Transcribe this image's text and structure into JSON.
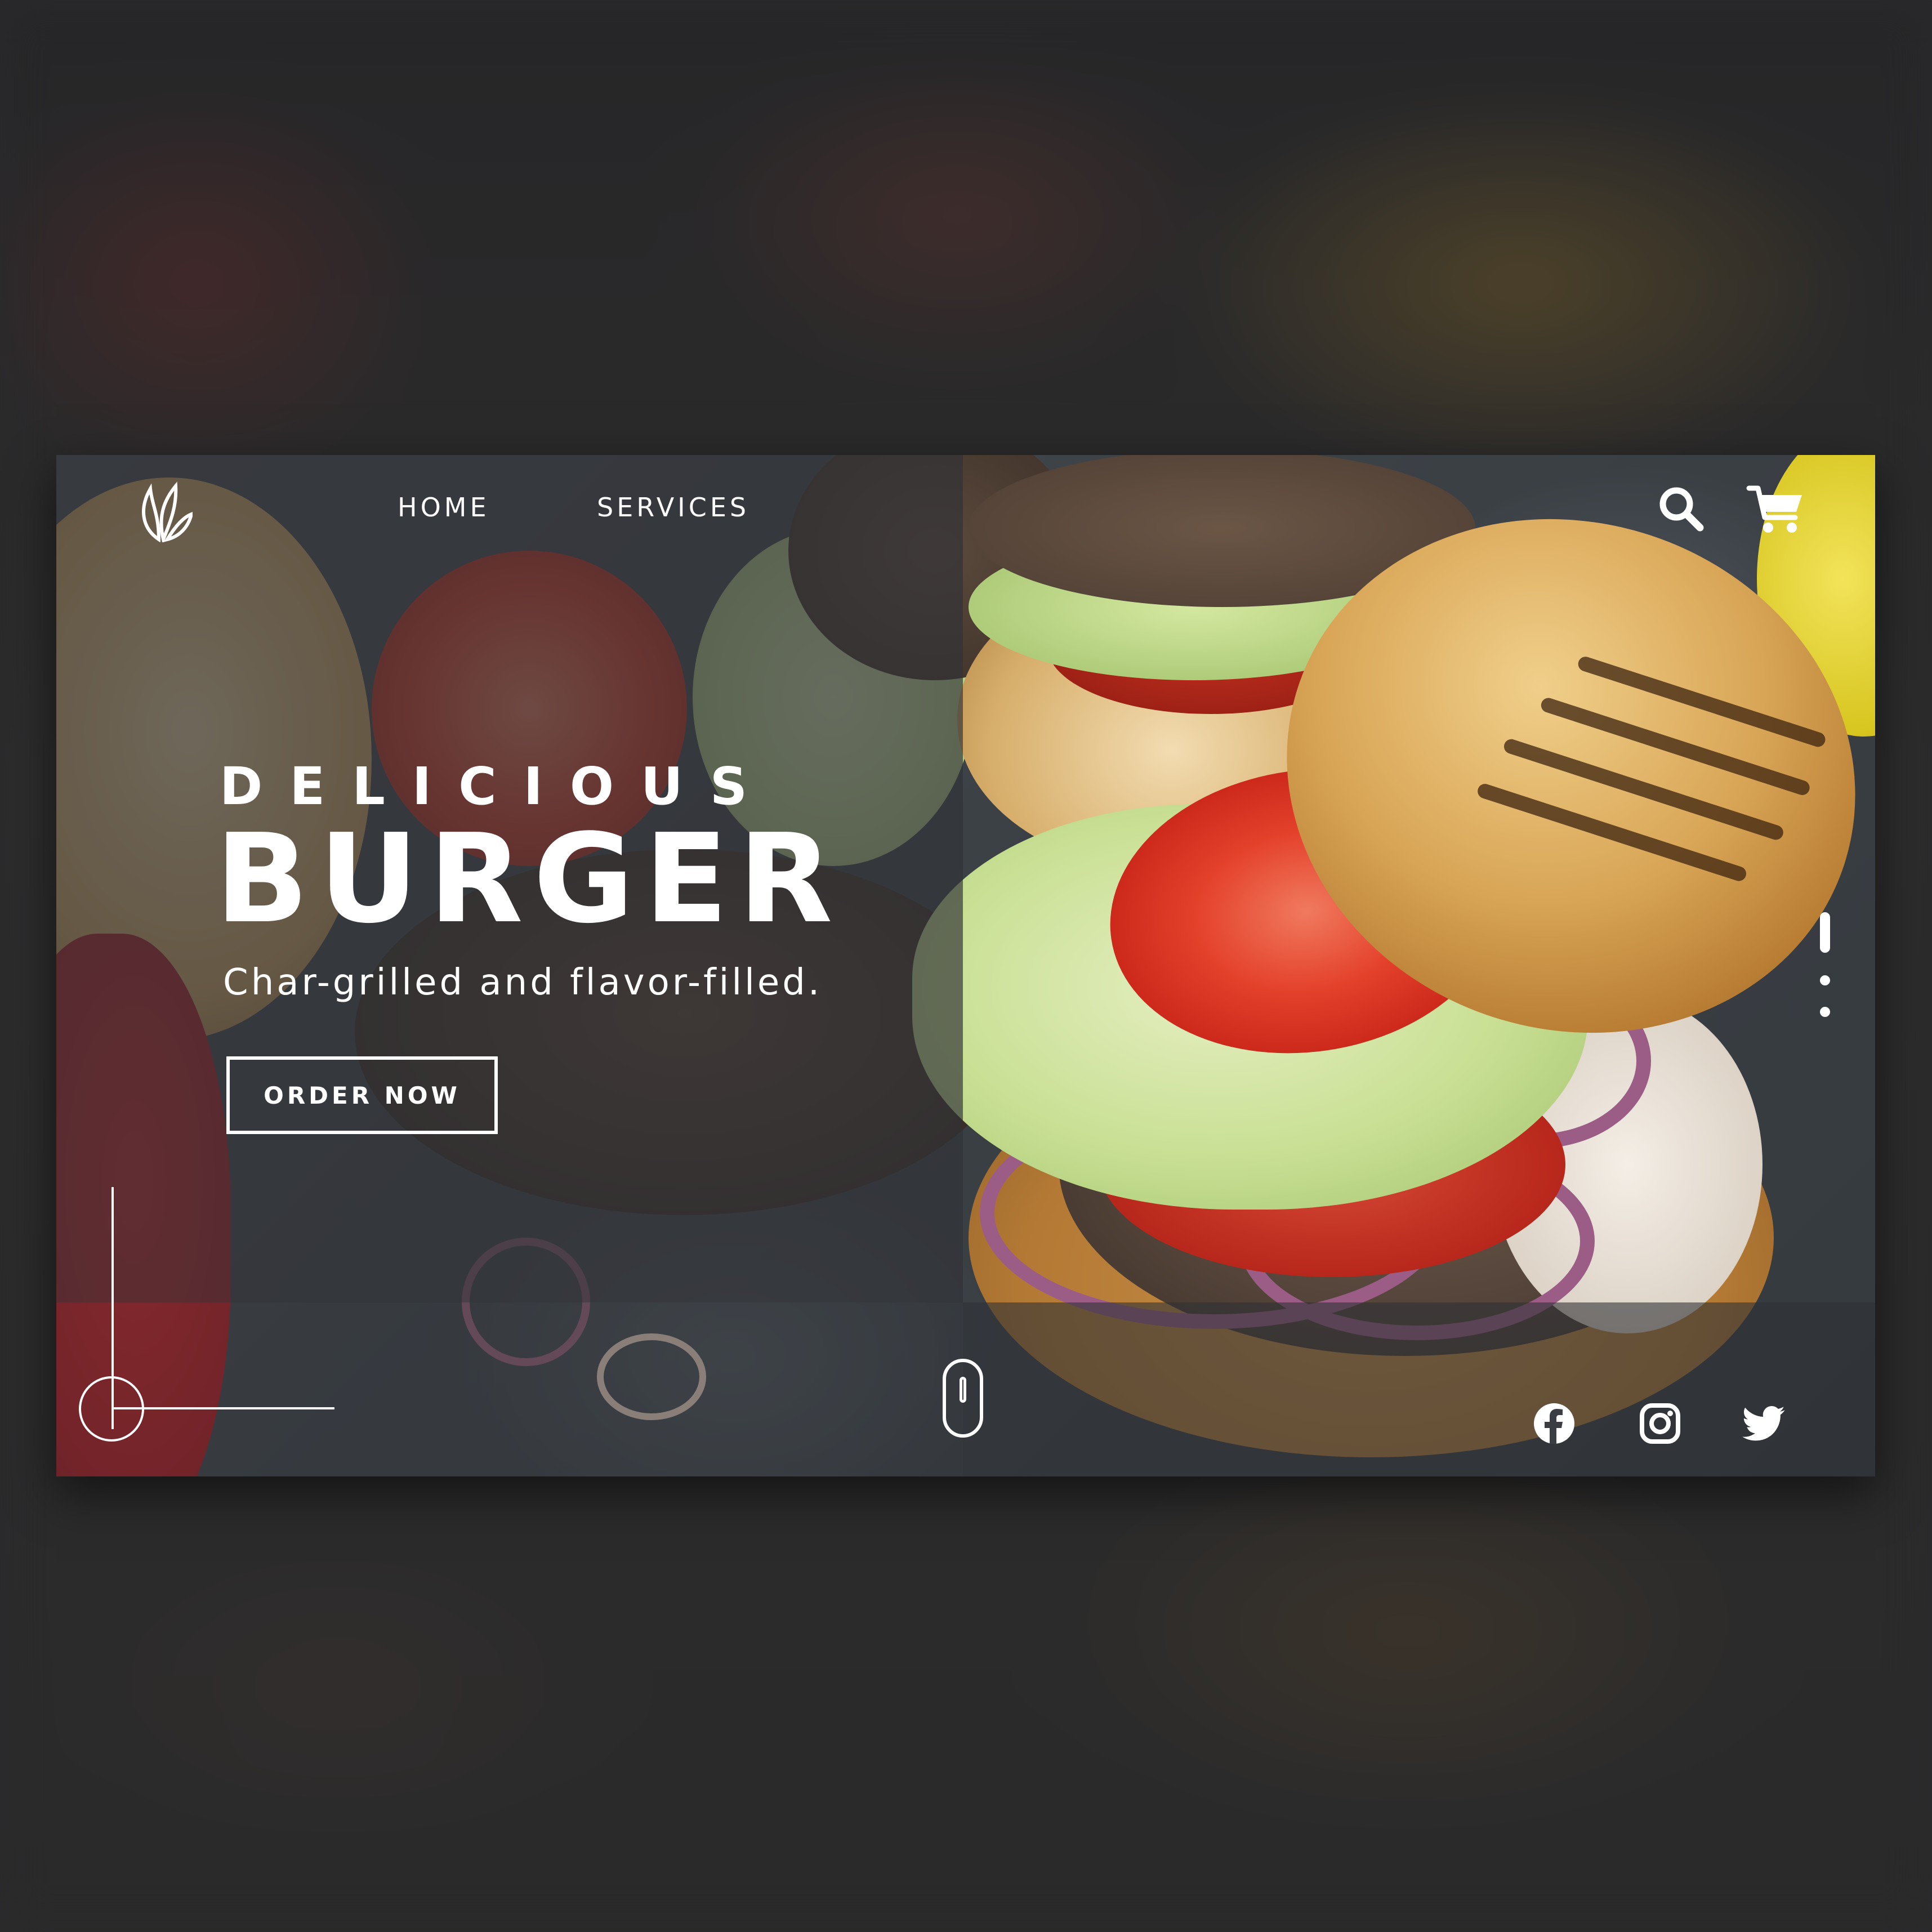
{
  "brand": {
    "logo_icon": "leaf-flame-icon"
  },
  "nav": {
    "items": [
      {
        "label": "HOME"
      },
      {
        "label": "SERVICES"
      }
    ]
  },
  "header_icons": {
    "search": "search-icon",
    "cart": "cart-icon"
  },
  "hero": {
    "eyebrow": "DELICIOUS",
    "headline": "BURGER",
    "tagline": "Char-grilled and flavor-filled.",
    "cta_label": "ORDER NOW"
  },
  "pager": {
    "count": 3,
    "active_index": 0
  },
  "social": [
    "facebook-icon",
    "instagram-icon",
    "twitter-icon"
  ],
  "colors": {
    "overlay": "#303236",
    "text": "#ffffff",
    "background": "#2a2a2c"
  }
}
